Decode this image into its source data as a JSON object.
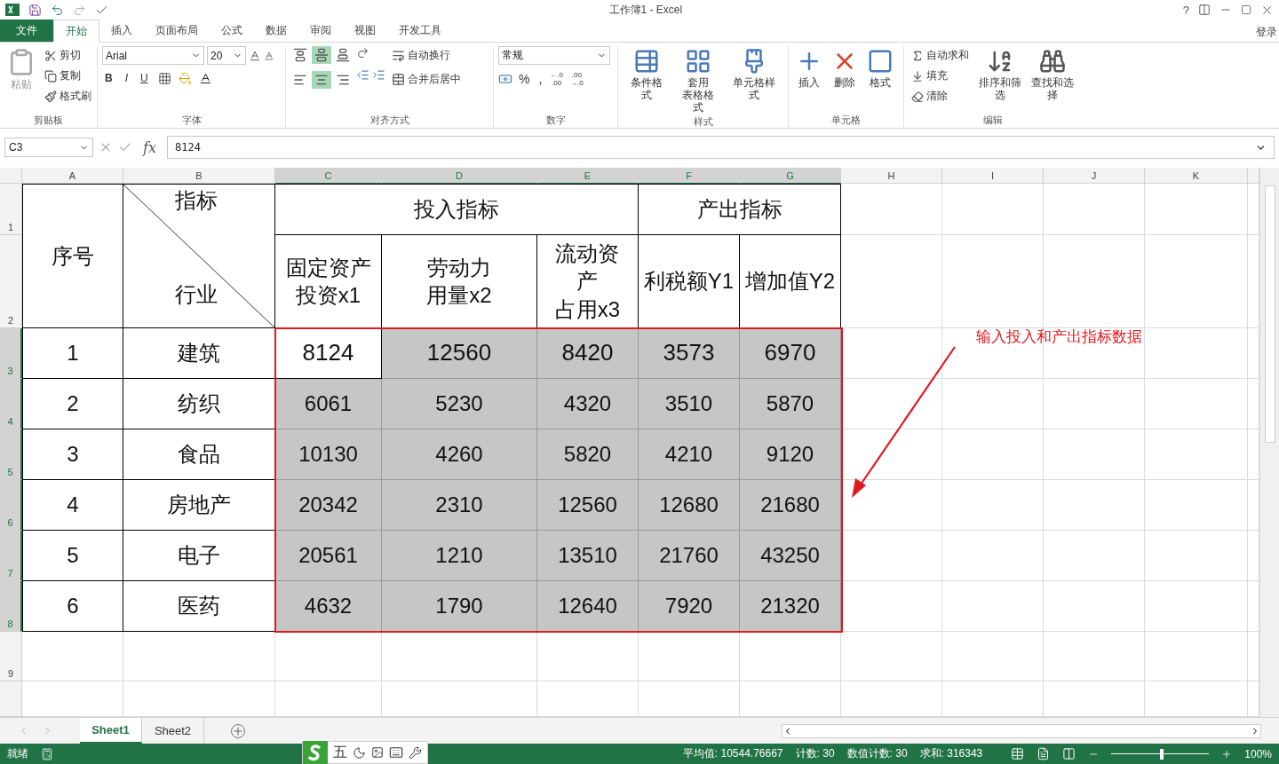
{
  "window": {
    "title": "工作簿1 - Excel",
    "help": "?"
  },
  "ribbon_tabs": [
    {
      "label": "文件",
      "kind": "file",
      "selected": false
    },
    {
      "label": "开始",
      "kind": "tab",
      "selected": true
    },
    {
      "label": "插入",
      "kind": "tab",
      "selected": false
    },
    {
      "label": "页面布局",
      "kind": "tab",
      "selected": false
    },
    {
      "label": "公式",
      "kind": "tab",
      "selected": false
    },
    {
      "label": "数据",
      "kind": "tab",
      "selected": false
    },
    {
      "label": "审阅",
      "kind": "tab",
      "selected": false
    },
    {
      "label": "视图",
      "kind": "tab",
      "selected": false
    },
    {
      "label": "开发工具",
      "kind": "tab",
      "selected": false
    }
  ],
  "sign_in": "登录",
  "ribbon": {
    "clipboard": {
      "label": "剪贴板",
      "paste": "粘贴",
      "small": [
        "剪切",
        "复制",
        "格式刷"
      ]
    },
    "font": {
      "label": "字体",
      "font": "Arial",
      "size": "20",
      "styles": [
        "B",
        "I",
        "U"
      ]
    },
    "alignment": {
      "label": "对齐方式",
      "vertical": [
        {
          "selected": false
        },
        {
          "selected": true
        },
        {
          "selected": false
        }
      ],
      "horizontal": [
        {
          "selected": false
        },
        {
          "selected": true
        },
        {
          "selected": false
        }
      ],
      "wrap": "自动换行",
      "merge": "合并后居中"
    },
    "number": {
      "label": "数字",
      "format": "常规",
      "symbols": [
        "%",
        ","
      ],
      "decimals": [
        {
          "top": "←.0",
          "bottom": ".00"
        },
        {
          "top": ".00",
          "bottom": "→.0"
        }
      ]
    },
    "styles": {
      "label": "样式",
      "buttons": [
        [
          "条件格式"
        ],
        [
          "套用",
          "表格格式"
        ],
        [
          "单元格样式"
        ]
      ]
    },
    "cells": {
      "label": "单元格",
      "buttons": [
        "插入",
        "删除",
        "格式"
      ]
    },
    "editing": {
      "label": "编辑",
      "small": [
        "自动求和",
        "填充",
        "清除"
      ],
      "buttons": [
        "排序和筛选",
        "查找和选择"
      ]
    }
  },
  "formula_bar": {
    "name_box": "C3",
    "fx": "fx",
    "value": "8124"
  },
  "sheet": {
    "columns": [
      {
        "label": "A",
        "selected": false
      },
      {
        "label": "B",
        "selected": false
      },
      {
        "label": "C",
        "selected": true
      },
      {
        "label": "D",
        "selected": true
      },
      {
        "label": "E",
        "selected": true
      },
      {
        "label": "F",
        "selected": true
      },
      {
        "label": "G",
        "selected": true
      },
      {
        "label": "H",
        "selected": false
      },
      {
        "label": "I",
        "selected": false
      },
      {
        "label": "J",
        "selected": false
      },
      {
        "label": "K",
        "selected": false
      }
    ],
    "row_numbers": [
      {
        "label": "1",
        "selected": false
      },
      {
        "label": "2",
        "selected": false
      },
      {
        "label": "3",
        "selected": true
      },
      {
        "label": "4",
        "selected": true
      },
      {
        "label": "5",
        "selected": true
      },
      {
        "label": "6",
        "selected": true
      },
      {
        "label": "7",
        "selected": true
      },
      {
        "label": "8",
        "selected": true
      },
      {
        "label": "9",
        "selected": false
      }
    ],
    "table": {
      "seq_header": "序号",
      "indicator_header": "指标",
      "industry_header": "行业",
      "input_group": "投入指标",
      "output_group": "产出指标",
      "measures": [
        [
          "固定资产",
          "投资x1"
        ],
        [
          "劳动力",
          "用量x2"
        ],
        [
          "流动资",
          "产",
          "占用x3"
        ],
        [
          "利税额Y1"
        ],
        [
          "增加值Y2"
        ]
      ],
      "rows": [
        {
          "seq": "1",
          "industry": "建筑",
          "values": [
            {
              "text": "8124",
              "selected": true,
              "active": true
            },
            {
              "text": "12560",
              "selected": true,
              "active": false
            },
            {
              "text": "8420",
              "selected": true,
              "active": false
            },
            {
              "text": "3573",
              "selected": true,
              "active": false
            },
            {
              "text": "6970",
              "selected": true,
              "active": false
            }
          ]
        },
        {
          "seq": "2",
          "industry": "纺织",
          "values": [
            {
              "text": "6061",
              "selected": true,
              "active": false
            },
            {
              "text": "5230",
              "selected": true,
              "active": false
            },
            {
              "text": "4320",
              "selected": true,
              "active": false
            },
            {
              "text": "3510",
              "selected": true,
              "active": false
            },
            {
              "text": "5870",
              "selected": true,
              "active": false
            }
          ]
        },
        {
          "seq": "3",
          "industry": "食品",
          "values": [
            {
              "text": "10130",
              "selected": true,
              "active": false
            },
            {
              "text": "4260",
              "selected": true,
              "active": false
            },
            {
              "text": "5820",
              "selected": true,
              "active": false
            },
            {
              "text": "4210",
              "selected": true,
              "active": false
            },
            {
              "text": "9120",
              "selected": true,
              "active": false
            }
          ]
        },
        {
          "seq": "4",
          "industry": "房地产",
          "values": [
            {
              "text": "20342",
              "selected": true,
              "active": false
            },
            {
              "text": "2310",
              "selected": true,
              "active": false
            },
            {
              "text": "12560",
              "selected": true,
              "active": false
            },
            {
              "text": "12680",
              "selected": true,
              "active": false
            },
            {
              "text": "21680",
              "selected": true,
              "active": false
            }
          ]
        },
        {
          "seq": "5",
          "industry": "电子",
          "values": [
            {
              "text": "20561",
              "selected": true,
              "active": false
            },
            {
              "text": "1210",
              "selected": true,
              "active": false
            },
            {
              "text": "13510",
              "selected": true,
              "active": false
            },
            {
              "text": "21760",
              "selected": true,
              "active": false
            },
            {
              "text": "43250",
              "selected": true,
              "active": false
            }
          ]
        },
        {
          "seq": "6",
          "industry": "医药",
          "values": [
            {
              "text": "4632",
              "selected": true,
              "active": false
            },
            {
              "text": "1790",
              "selected": true,
              "active": false
            },
            {
              "text": "12640",
              "selected": true,
              "active": false
            },
            {
              "text": "7920",
              "selected": true,
              "active": false
            },
            {
              "text": "21320",
              "selected": true,
              "active": false
            }
          ]
        }
      ]
    },
    "annotation": "输入投入和产出指标数据"
  },
  "sheet_tabs": [
    {
      "label": "Sheet1",
      "selected": true
    },
    {
      "label": "Sheet2",
      "selected": false
    }
  ],
  "ime_bar": {
    "mode": "五"
  },
  "status_bar": {
    "ready": "就绪",
    "stats": [
      "平均值: 10544.76667",
      "计数: 30",
      "数值计数: 30",
      "求和: 316343"
    ],
    "zoom": "100%",
    "zoom_slider": {
      "level": 0.5
    }
  }
}
